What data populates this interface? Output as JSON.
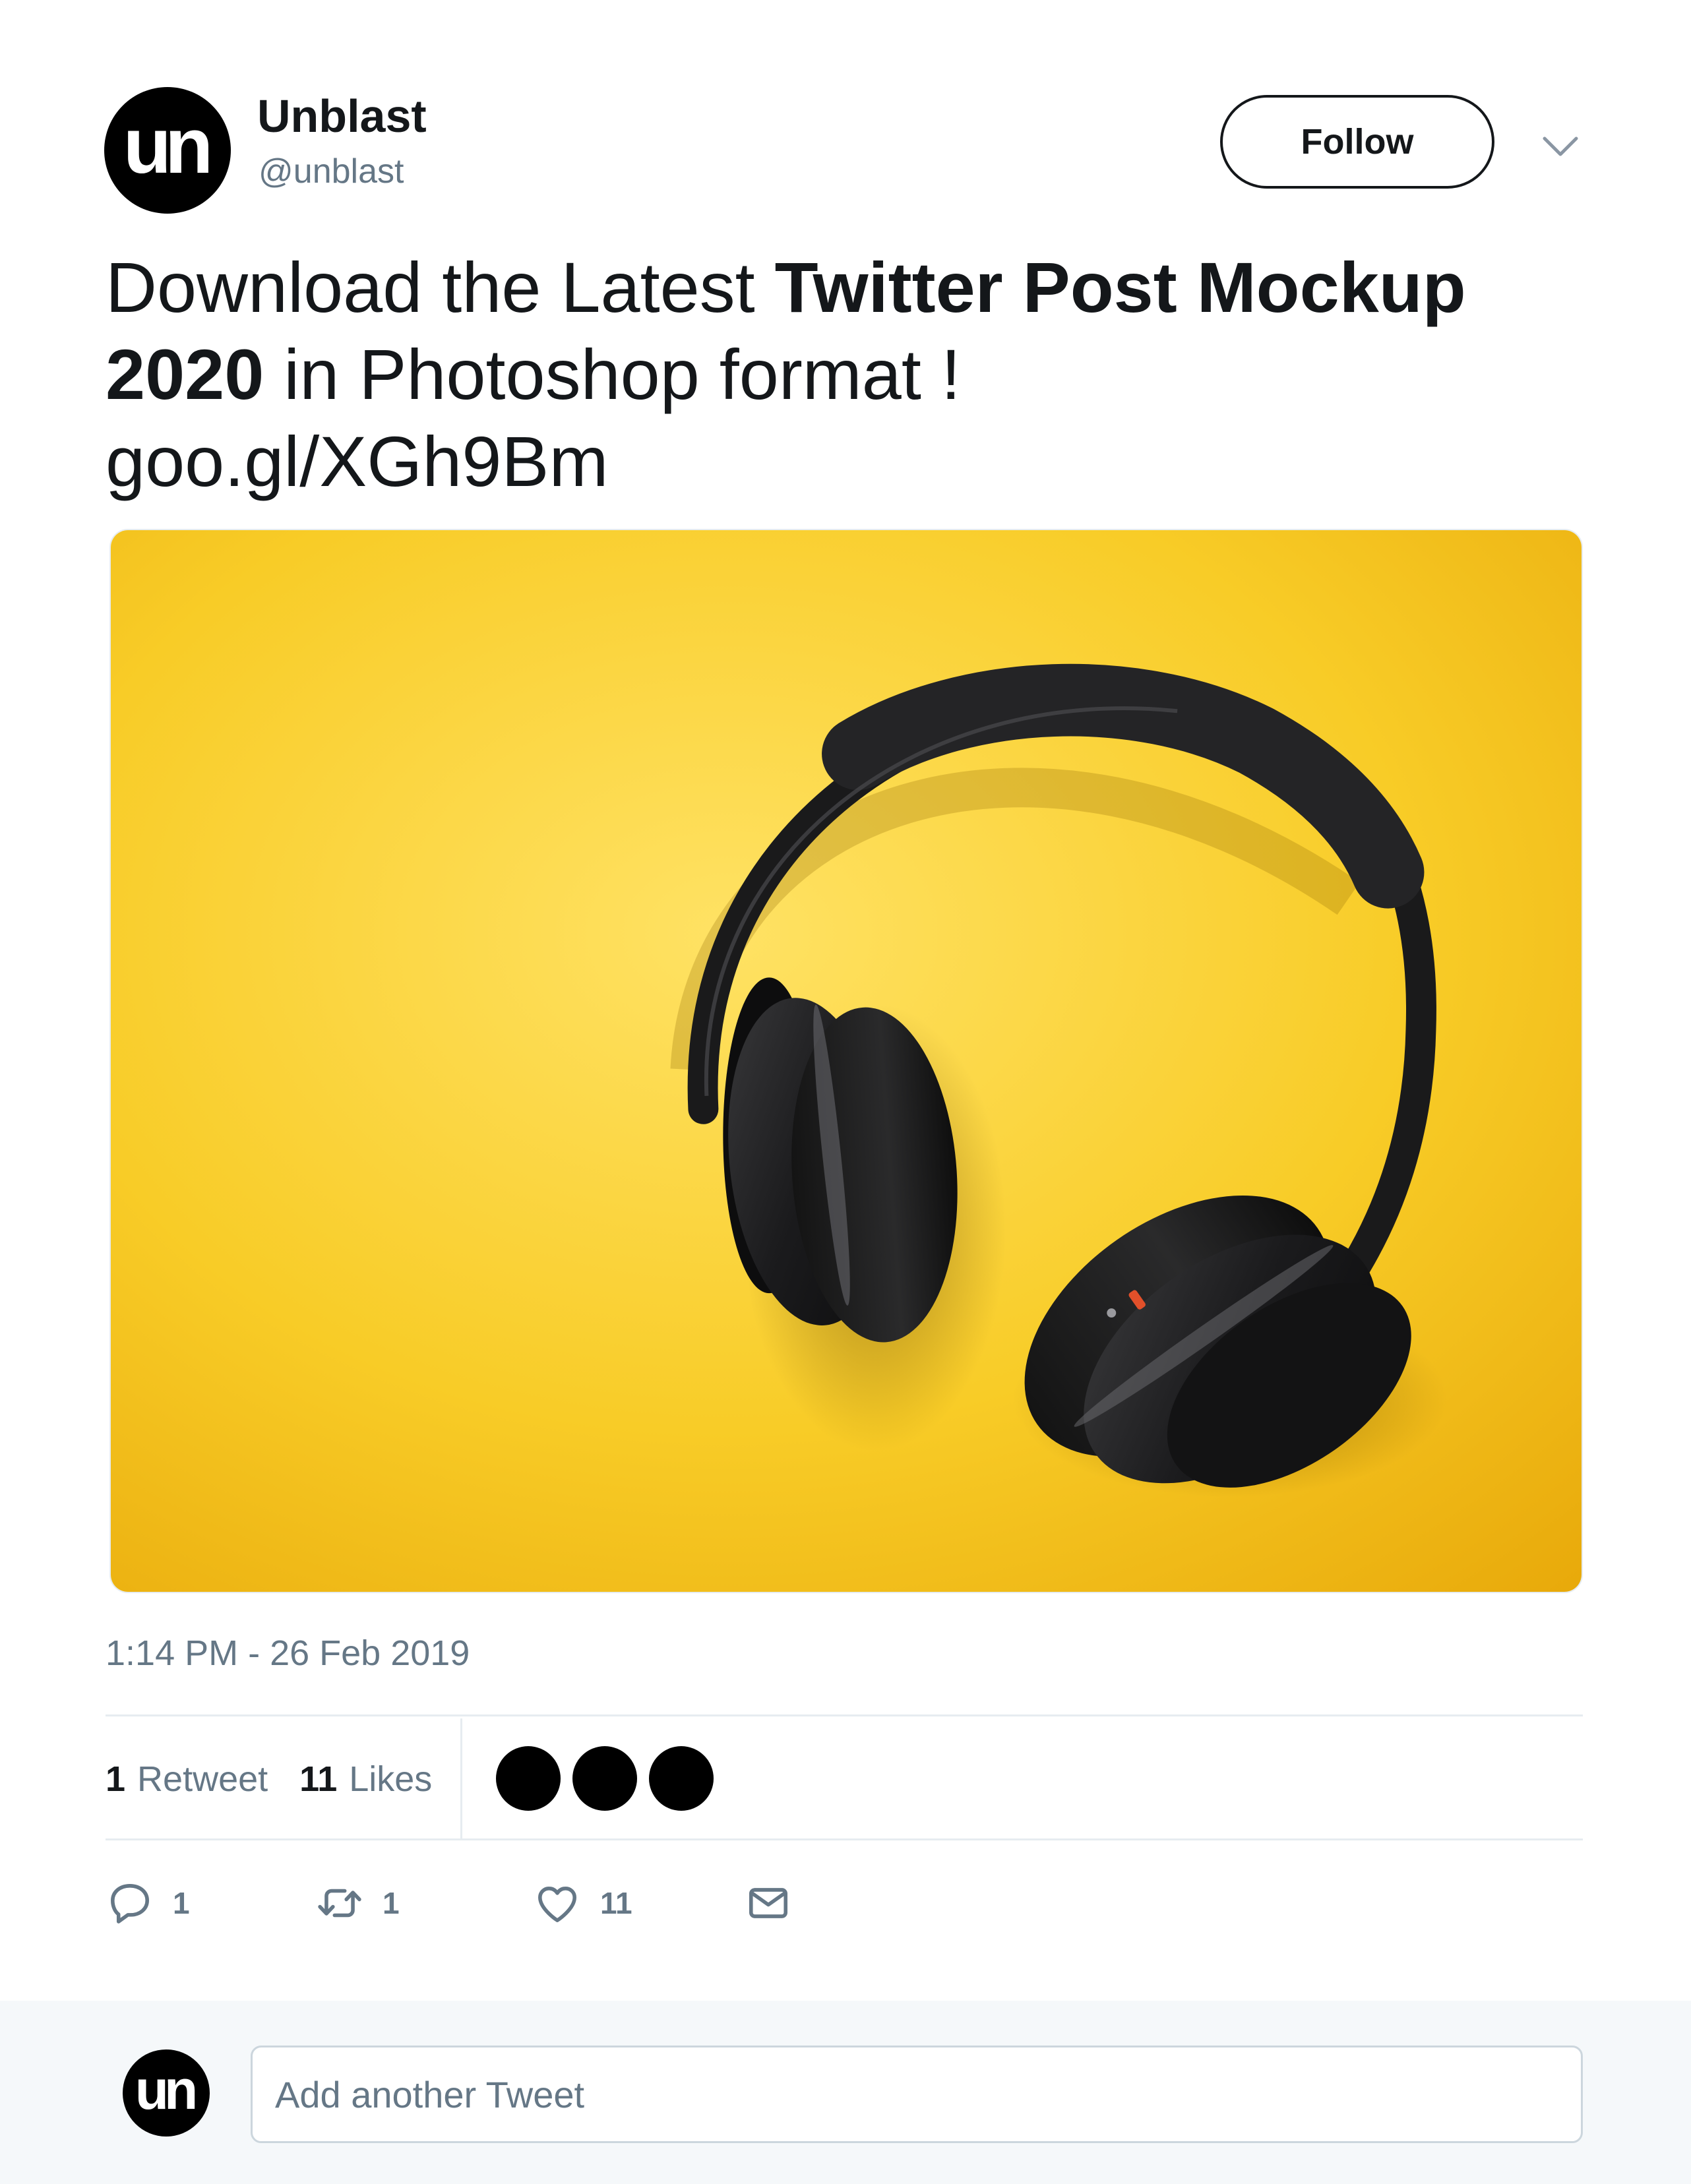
{
  "author": {
    "avatar_initials": "un",
    "display_name": "Unblast",
    "handle": "@unblast"
  },
  "header": {
    "follow_label": "Follow"
  },
  "tweet": {
    "text_part1": "Download the Latest ",
    "text_bold": "Twitter Post Mockup 2020",
    "text_part2": " in Photoshop format !",
    "link": "goo.gl/XGh9Bm",
    "timestamp": "1:14 PM - 26 Feb 2019",
    "media_subject": "black headphones on yellow background"
  },
  "stats": {
    "retweet_count": "1",
    "retweet_label": "Retweet",
    "likes_count": "11",
    "likes_label": "Likes",
    "likers_shown": 3
  },
  "actions": {
    "reply_count": "1",
    "retweet_count": "1",
    "like_count": "11"
  },
  "reply": {
    "avatar_initials": "un",
    "placeholder": "Add another Tweet"
  },
  "colors": {
    "text": "#14171a",
    "secondary": "#657786",
    "divider": "#e6ecf0",
    "reply_bar_bg": "#f5f8fa",
    "media_yellow": "#f7c21a"
  },
  "icons": [
    "chevron-down-icon",
    "reply-icon",
    "retweet-icon",
    "heart-icon",
    "mail-icon"
  ]
}
